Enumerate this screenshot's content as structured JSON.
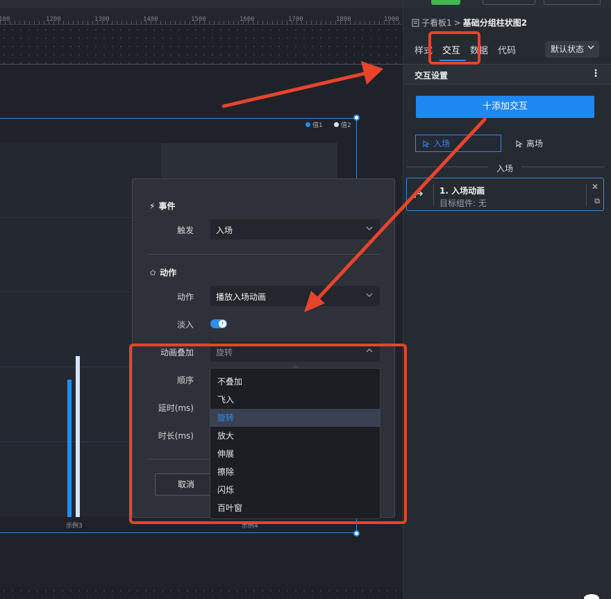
{
  "ruler": {
    "ticks": [
      "100",
      "1200",
      "1300",
      "1400",
      "1500",
      "1600",
      "1700",
      "1800",
      "1900"
    ]
  },
  "chart": {
    "legend": [
      "值1",
      "值2"
    ],
    "x_labels": [
      "示例3",
      "示例4"
    ],
    "colors": {
      "series1": "#1d8ff0",
      "series2": "#d6e4f7"
    }
  },
  "chart_data": {
    "type": "bar",
    "categories": [
      "示例3",
      "示例4"
    ],
    "series": [
      {
        "name": "值1",
        "values": [
          198,
          null
        ]
      },
      {
        "name": "值2",
        "values": [
          232,
          null
        ]
      }
    ]
  },
  "panel": {
    "breadcrumb": {
      "parent": "子看板1",
      "separator": ">",
      "current": "基础分组柱状图2"
    },
    "tabs": [
      "样式",
      "交互",
      "数据",
      "代码"
    ],
    "active_tab": "交互",
    "state_select": "默认状态",
    "section_title": "交互设置",
    "add_button": "十添加交互",
    "segments": {
      "enter": "入场",
      "leave": "离场"
    },
    "divider_title": "入场",
    "card": {
      "title": "1. 入场动画",
      "subtitle": "目标组件: 无"
    }
  },
  "modal": {
    "event_header": "事件",
    "trigger_label": "触发",
    "trigger_value": "入场",
    "action_header": "动作",
    "action_label": "动作",
    "action_value": "播放入场动画",
    "fade_label": "淡入",
    "fade_on": true,
    "overlay_label": "动画叠加",
    "overlay_value": "旋转",
    "order_label": "顺序",
    "delay_label": "延时(ms)",
    "duration_label": "时长(ms)",
    "cancel_button": "取消"
  },
  "dropdown": {
    "options": [
      "不叠加",
      "飞入",
      "旋转",
      "放大",
      "伸展",
      "擦除",
      "闪烁",
      "百叶窗"
    ],
    "selected": "旋转"
  },
  "annotations": {
    "color": "#e8442c"
  }
}
